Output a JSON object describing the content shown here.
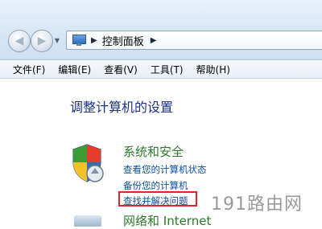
{
  "address_bar": {
    "breadcrumb": "控制面板"
  },
  "menu": {
    "items": [
      "文件(F)",
      "编辑(E)",
      "查看(V)",
      "工具(T)",
      "帮助(H)"
    ]
  },
  "main": {
    "title": "调整计算机的设置",
    "categories": [
      {
        "title": "系统和安全",
        "icon": "shield-icon",
        "links": [
          "查看您的计算机状态",
          "备份您的计算机",
          "查找并解决问题"
        ]
      },
      {
        "title": "网络和 Internet",
        "icon": "network-icon"
      }
    ]
  },
  "watermark": "191路由网",
  "colors": {
    "link": "#0b4fa0",
    "category": "#2a7a2a",
    "title": "#1e3287",
    "highlight_box": "#e0242a"
  }
}
